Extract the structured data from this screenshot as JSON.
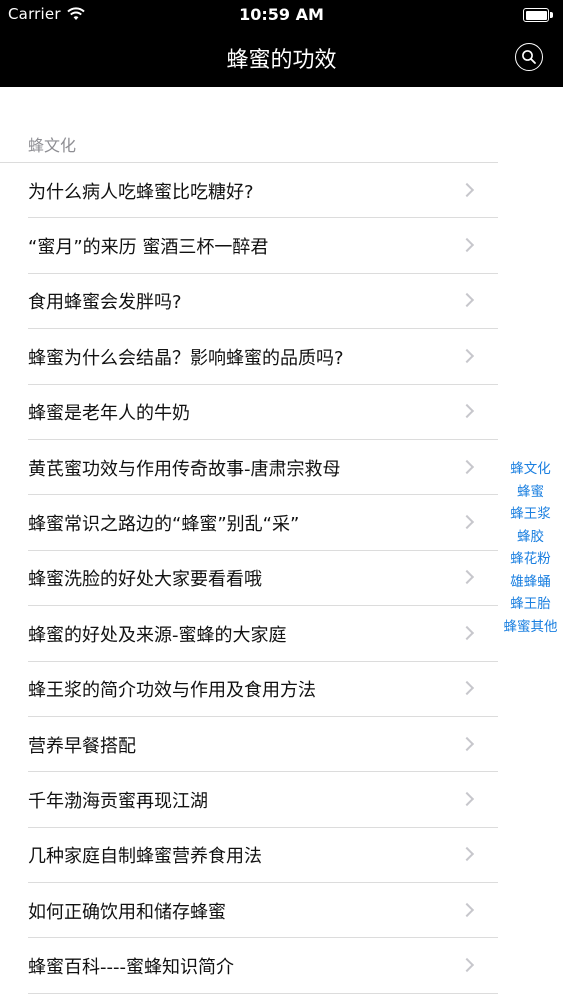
{
  "status_bar": {
    "carrier": "Carrier",
    "time": "10:59 AM"
  },
  "nav": {
    "title": "蜂蜜的功效",
    "search_icon": "search-icon"
  },
  "section": {
    "header": "蜂文化"
  },
  "rows": [
    "为什么病人吃蜂蜜比吃糖好?",
    "“蜜月”的来历 蜜酒三杯一醉君",
    "食用蜂蜜会发胖吗?",
    "蜂蜜为什么会结晶？影响蜂蜜的品质吗?",
    "蜂蜜是老年人的牛奶",
    "黄芪蜜功效与作用传奇故事-唐肃宗救母",
    "蜂蜜常识之路边的“蜂蜜”别乱“采”",
    "蜂蜜洗脸的好处大家要看看哦",
    "蜂蜜的好处及来源-蜜蜂的大家庭",
    "蜂王浆的简介功效与作用及食用方法",
    "营养早餐搭配",
    "千年渤海贡蜜再现江湖",
    "几种家庭自制蜂蜜营养食用法",
    "如何正确饮用和储存蜂蜜",
    "蜂蜜百科----蜜蜂知识简介"
  ],
  "index": [
    "蜂文化",
    "蜂蜜",
    "蜂王浆",
    "蜂胶",
    "蜂花粉",
    "雄蜂蛹",
    "蜂王胎",
    "蜂蜜其他"
  ],
  "colors": {
    "nav_background": "#000000",
    "index_accent": "#1a7fe0",
    "separator": "#dcdcdc",
    "section_text": "#8e8e93"
  }
}
